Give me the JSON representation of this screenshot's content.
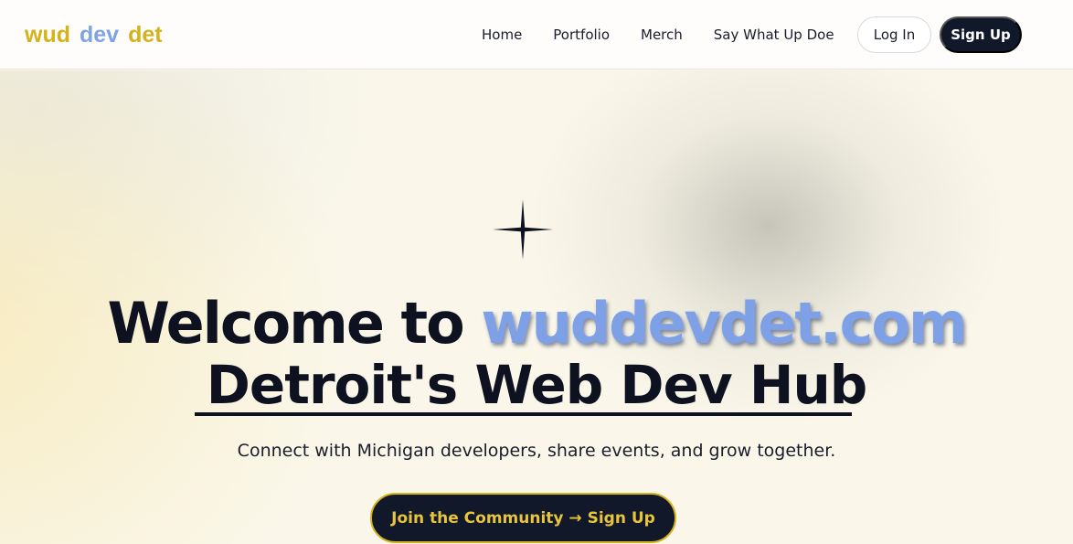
{
  "logo": {
    "part1": "wud",
    "part2": "dev",
    "part3": "det"
  },
  "nav": {
    "items": [
      {
        "label": "Home"
      },
      {
        "label": "Portfolio"
      },
      {
        "label": "Merch"
      },
      {
        "label": "Say What Up Doe"
      }
    ],
    "login_label": "Log In",
    "signup_label": "Sign Up"
  },
  "hero": {
    "sparkle_icon": "four-point-star-icon",
    "title_prefix": "Welcome to ",
    "title_highlight": "wuddevdet.com",
    "title_line2": "Detroit's Web Dev Hub",
    "subtitle": "Connect with Michigan developers, share events, and grow together.",
    "cta_label": "Join the Community → Sign Up"
  },
  "colors": {
    "brand_yellow": "#d4b21c",
    "brand_blue": "#7ea4e4",
    "dark_navy": "#111829"
  }
}
